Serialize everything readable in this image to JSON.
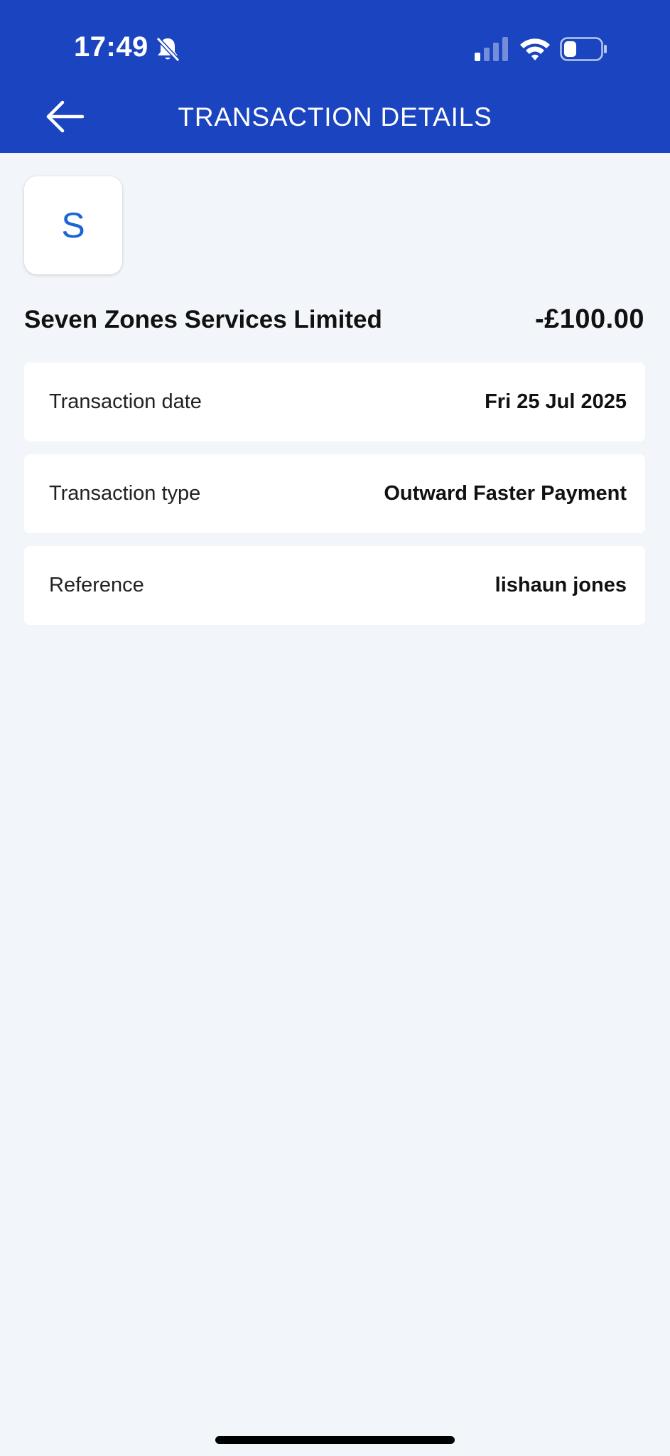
{
  "status_bar": {
    "time": "17:49"
  },
  "header": {
    "title": "TRANSACTION DETAILS",
    "back_icon": "arrow-left-icon"
  },
  "colors": {
    "header_bg": "#1a44c0",
    "page_bg": "#f2f5f9",
    "avatar_letter": "#1a64d6"
  },
  "transaction": {
    "avatar_letter": "S",
    "merchant": "Seven Zones Services Limited",
    "amount": "-£100.00",
    "details": [
      {
        "label": "Transaction date",
        "value": "Fri 25 Jul 2025"
      },
      {
        "label": "Transaction type",
        "value": "Outward Faster Payment"
      },
      {
        "label": "Reference",
        "value": "lishaun jones"
      }
    ]
  }
}
